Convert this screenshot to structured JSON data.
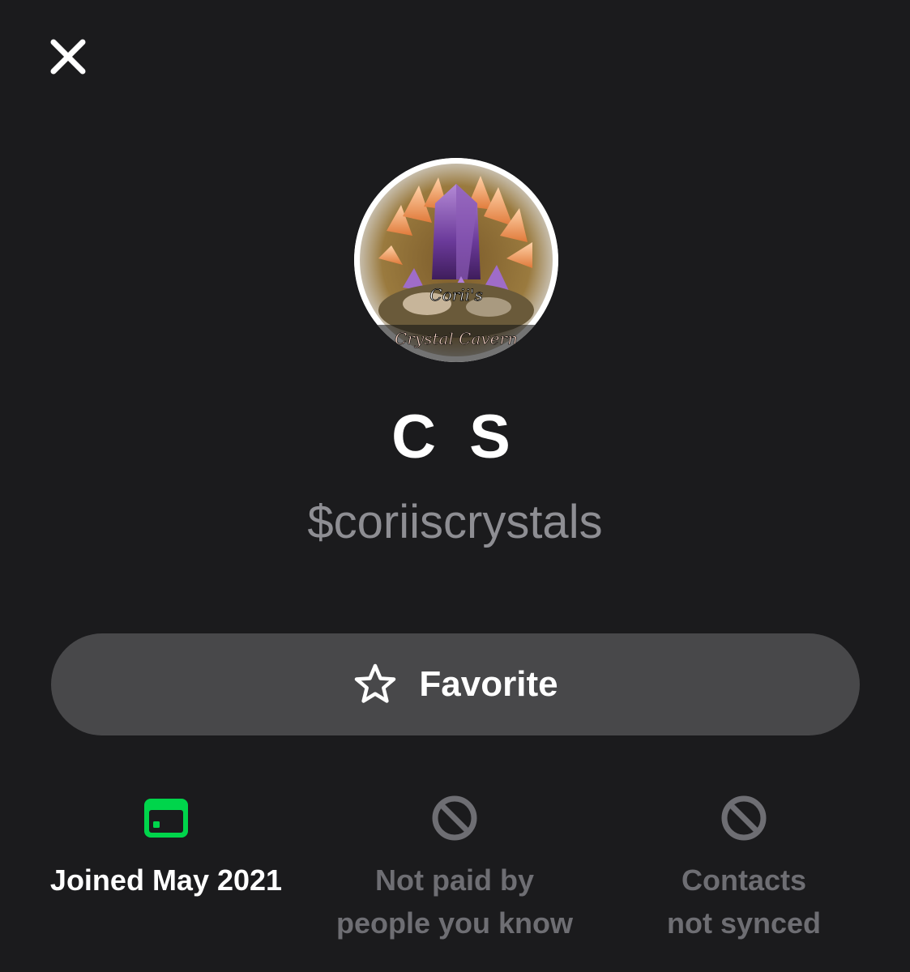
{
  "header": {
    "close_icon": "close-icon"
  },
  "profile": {
    "avatar_icon": "crystal-avatar-image",
    "avatar_text_line1": "Corii's",
    "avatar_text_line2": "Crystal Cavern",
    "display_name": "C S",
    "cashtag": "$coriiscrystals"
  },
  "actions": {
    "favorite_icon": "star-outline-icon",
    "favorite_label": "Favorite"
  },
  "info": [
    {
      "icon": "calendar-icon",
      "text": "Joined May 2021",
      "color": "#00d54b",
      "status": "active"
    },
    {
      "icon": "blocked-icon",
      "line1": "Not paid by",
      "line2": "people you know",
      "status": "muted"
    },
    {
      "icon": "blocked-icon",
      "line1": "Contacts",
      "line2": "not synced",
      "status": "muted"
    }
  ],
  "colors": {
    "background": "#1b1b1d",
    "button": "#48484a",
    "muted_text": "#6e6e73",
    "accent_green": "#00d54b"
  }
}
